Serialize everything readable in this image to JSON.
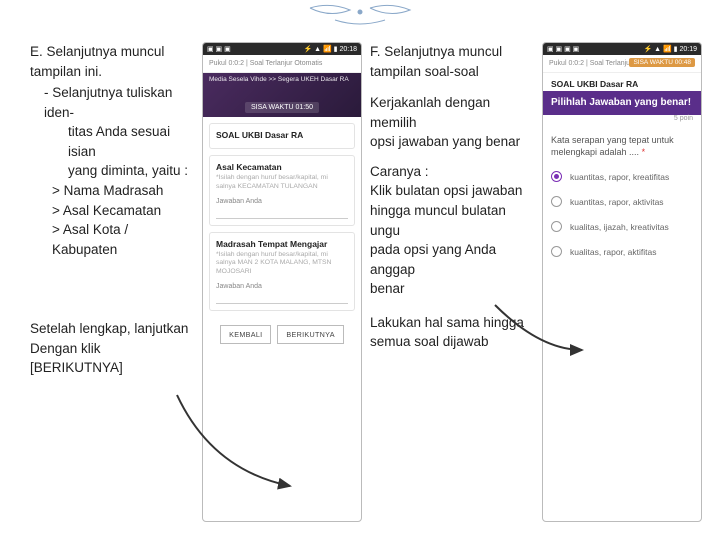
{
  "decor": true,
  "left": {
    "heading": "E. Selanjutnya muncul tampilan ini.",
    "sub1": "- Selanjutnya tuliskan iden-",
    "sub1b": "titas Anda sesuai isian",
    "sub1c": "yang diminta, yaitu :",
    "b1": "> Nama Madrasah",
    "b2": "> Asal Kecamatan",
    "b3": "> Asal Kota / Kabupaten",
    "lower1": "Setelah lengkap, lanjutkan",
    "lower2": "Dengan klik [BERIKUTNYA]"
  },
  "phone1": {
    "status_left": "▣ ▣ ▣",
    "status_right": "⚡ ▲ 📶 ▮ 20:18",
    "app_left": "Pukul 0:0:2 | Soal Terlanjur Otomatis",
    "hero_l1": "Media Sesela Vihde >> Segera UKEH Dasar RA",
    "timer": "SISA WAKTU 01:50",
    "subject": "SOAL UKBI Dasar RA",
    "sec1_title": "Asal Kecamatan",
    "sec1_hint": "*Isilah dengan huruf besar/kapital, mi salnya KECAMATAN TULANGAN",
    "answer_label": "Jawaban Anda",
    "sec2_title": "Madrasah Tempat Mengajar",
    "sec2_hint": "*Isilah dengan huruf besar/kapital, mi salnya  MAN 2 KOTA MALANG, MTSN MOJOSARI",
    "answer_label2": "Jawaban Anda",
    "btn_back": "KEMBALI",
    "btn_next": "BERIKUTNYA"
  },
  "right": {
    "heading": "F. Selanjutnya muncul tampilan soal-soal",
    "p1": "Kerjakanlah dengan memilih",
    "p1b": "opsi jawaban yang benar",
    "p2": "Caranya :",
    "p3": "Klik bulatan opsi jawaban",
    "p3b": "hingga muncul bulatan ungu",
    "p3c": "pada opsi yang Anda anggap",
    "p3d": "benar",
    "p4": "Lakukan hal sama hingga",
    "p4b": "semua soal dijawab"
  },
  "phone2": {
    "status_left": "▣ ▣ ▣ ▣",
    "status_right": "⚡ ▲ 📶 ▮ 20:19",
    "app_left": "Pukul 0:0:2 | Soal Terlanjur Otomatis",
    "timer_pill": "SISA WAKTU 00:48",
    "subject": "SOAL UKBI Dasar RA",
    "purple": "Pilihlah Jawaban yang benar!",
    "question": "Kata serapan yang tepat untuk melengkapi adalah ....",
    "blank": "*",
    "points": "5 poin",
    "opts": [
      {
        "label": "kuantitas, rapor, kreatifitas",
        "selected": true
      },
      {
        "label": "kuantitas, rapor, aktivitas",
        "selected": false
      },
      {
        "label": "kualitas, ijazah, kreativitas",
        "selected": false
      },
      {
        "label": "kualitas, rapor, aktifitas",
        "selected": false
      }
    ]
  }
}
